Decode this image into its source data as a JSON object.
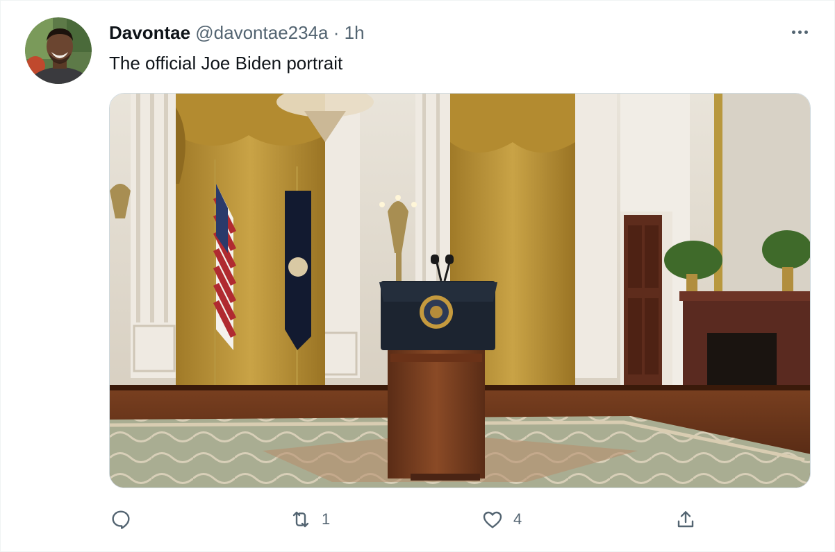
{
  "tweet": {
    "author_name": "Davontae",
    "author_handle": "@davontae234a",
    "separator": "·",
    "time": "1h",
    "text": "The official Joe Biden portrait"
  },
  "media": {
    "description_icon": "photo-podium-east-room"
  },
  "actions": {
    "reply": {
      "icon": "reply-icon",
      "count": ""
    },
    "retweet": {
      "icon": "retweet-icon",
      "count": "1"
    },
    "like": {
      "icon": "heart-icon",
      "count": "4"
    },
    "share": {
      "icon": "share-icon",
      "count": ""
    }
  },
  "colors": {
    "text_primary": "#0f1419",
    "text_secondary": "#536471",
    "border": "#cfd9de"
  }
}
